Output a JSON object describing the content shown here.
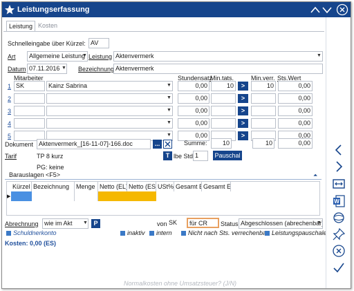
{
  "window": {
    "title": "Leistungserfassung"
  },
  "tabs": [
    {
      "label": "Leistung"
    },
    {
      "label": "Kosten"
    }
  ],
  "form": {
    "schnell_label": "Schnelleingabe über Kürzel:",
    "schnell_value": "AV",
    "art_label": "Art",
    "art_value": "Allgemeine Leistung",
    "leistung_label": "Leistung",
    "leistung_value": "Aktenvermerk",
    "datum_label": "Datum",
    "datum_value": "07.11.2016",
    "bezeichnung_label": "Bezeichnung",
    "bezeichnung_value": "Aktenvermerk",
    "mitarbeiter_label": "Mitarbeiter",
    "stundensatz_label": "Stundensatz",
    "min_tats_label": "Min.tats.",
    "min_verr_label": "Min.verr.",
    "sts_wert_label": "Sts.Wert",
    "rows": [
      {
        "num": "1",
        "code": "SK",
        "name": "Kainz Sabrina",
        "rate": "0,00",
        "min_tats": "10",
        "arrow": ">",
        "min_verr": "10",
        "wert": "0,00"
      },
      {
        "num": "2",
        "code": "",
        "name": "",
        "rate": "0,00",
        "min_tats": "",
        "arrow": ">",
        "min_verr": "",
        "wert": "0,00"
      },
      {
        "num": "3",
        "code": "",
        "name": "",
        "rate": "0,00",
        "min_tats": "",
        "arrow": ">",
        "min_verr": "",
        "wert": "0,00"
      },
      {
        "num": "4",
        "code": "",
        "name": "",
        "rate": "0,00",
        "min_tats": "",
        "arrow": ">",
        "min_verr": "",
        "wert": "0,00"
      },
      {
        "num": "5",
        "code": "",
        "name": "",
        "rate": "0,00",
        "min_tats": "",
        "arrow": ">",
        "min_verr": "",
        "wert": "0,00"
      }
    ],
    "summe_label": "Summe:",
    "summe_min_tats": "10",
    "summe_min_verr": "10",
    "summe_wert": "0,00",
    "dokument_label": "Dokument",
    "dokument_value": "Aktenvermerk_[16-11-07]-166.doc",
    "dokument_browse": "...",
    "tarif_label": "Tarif",
    "tarif_value": "TP 8 kurz",
    "tarif_btn": "T",
    "lbe_std_label": "lbe Std.",
    "lbe_std_value": "1",
    "pauschal_label": "Pauschal",
    "pg_label": "PG: keine",
    "barauslagen_label": "Barauslagen <F5>",
    "grid_headers": [
      "Kürzel",
      "Bezeichnung",
      "Menge",
      "Netto (EL)",
      "Netto (ES)",
      "USt%",
      "Gesamt EL",
      "Gesamt ES"
    ],
    "abrechnung_label": "Abrechnung",
    "abrechnung_value": "wie im Akt",
    "abrechnung_btn": "P",
    "von_label": "von",
    "von_value": "SK",
    "fuer_value": "für CR",
    "status_label": "Status",
    "status_value": "Abgeschlossen (abrechenbar)",
    "schuldnerkonto_label": "Schuldnerkonto",
    "inaktiv_label": "inaktiv",
    "intern_label": "intern",
    "nicht_label": "Nicht nach Sts. verrechenbar",
    "pauschale_label": "Leistungspauschale",
    "kosten_label": "Kosten: 0,00 (ES)",
    "footer_hint": "Normalkosten ohne Umsatzsteuer? (J/N)"
  },
  "colors": {
    "title_bar": "#16458c",
    "accent_blue": "#16458c",
    "grid_selected": "#f5b800",
    "grid_highlight": "#4a90e2"
  }
}
